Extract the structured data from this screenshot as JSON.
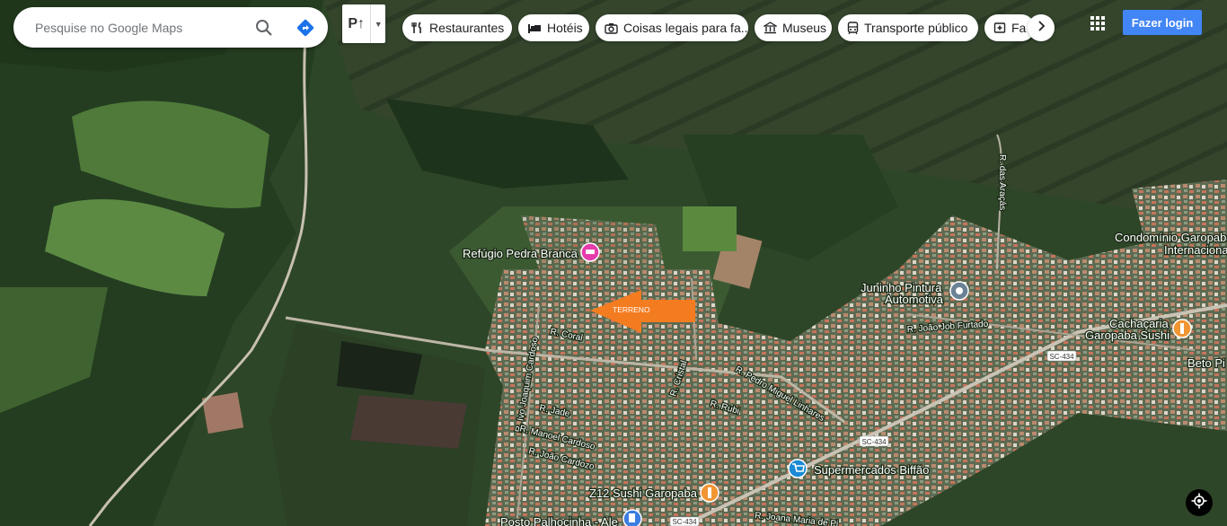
{
  "search": {
    "placeholder": "Pesquise no Google Maps"
  },
  "layers": {
    "icon": "P↑"
  },
  "chips": [
    {
      "icon": "restaurant-icon",
      "label": "Restaurantes"
    },
    {
      "icon": "hotel-icon",
      "label": "Hotéis"
    },
    {
      "icon": "camera-icon",
      "label": "Coisas legais para fa..."
    },
    {
      "icon": "museum-icon",
      "label": "Museus"
    },
    {
      "icon": "transit-icon",
      "label": "Transporte público"
    },
    {
      "icon": "pharmacy-icon",
      "label": "Fa"
    }
  ],
  "header": {
    "login_label": "Fazer login"
  },
  "places": {
    "refugio": "Refúgio Pedra Branca",
    "juninho_1": "Juninho Pintura",
    "juninho_2": "Automotiva",
    "cachacaria_1": "Cachaçaria",
    "cachacaria_2": "Garopaba Sushi",
    "condominio_1": "Condomínio Garopaba",
    "condominio_2": "Internacional",
    "beto": "Beto Pi",
    "supermercados": "Supermercados Biffão",
    "z12": "Z12 Sushi Garopaba",
    "posto": "Posto Palhocinha - Ale",
    "terreno": "TERRENO"
  },
  "streets": {
    "aracas": "R. das Araçás",
    "joaquim": "R. Ivo Joaquim Cardoso",
    "coral": "R. Coral",
    "cristal": "R. Cristal",
    "pedro": "R. Pedro Miguel Linhares",
    "rubi": "R. Rubi",
    "jade": "R. Jade",
    "manoel": "R. Manoel Cardoso",
    "joao_cardozo": "R. João Cardozo",
    "joao_job": "R. João Job Furtado",
    "joana": "R. Joana Maria de Pi"
  },
  "highway_badges": [
    "SC-434",
    "SC-434",
    "SC-434"
  ],
  "colors": {
    "accent": "#4285f4",
    "arrow": "#f47c20",
    "hotel_pin": "#e63cab",
    "food_pin": "#f29533",
    "shop_pin": "#1a8ad4",
    "gas_pin": "#3b7de0"
  }
}
